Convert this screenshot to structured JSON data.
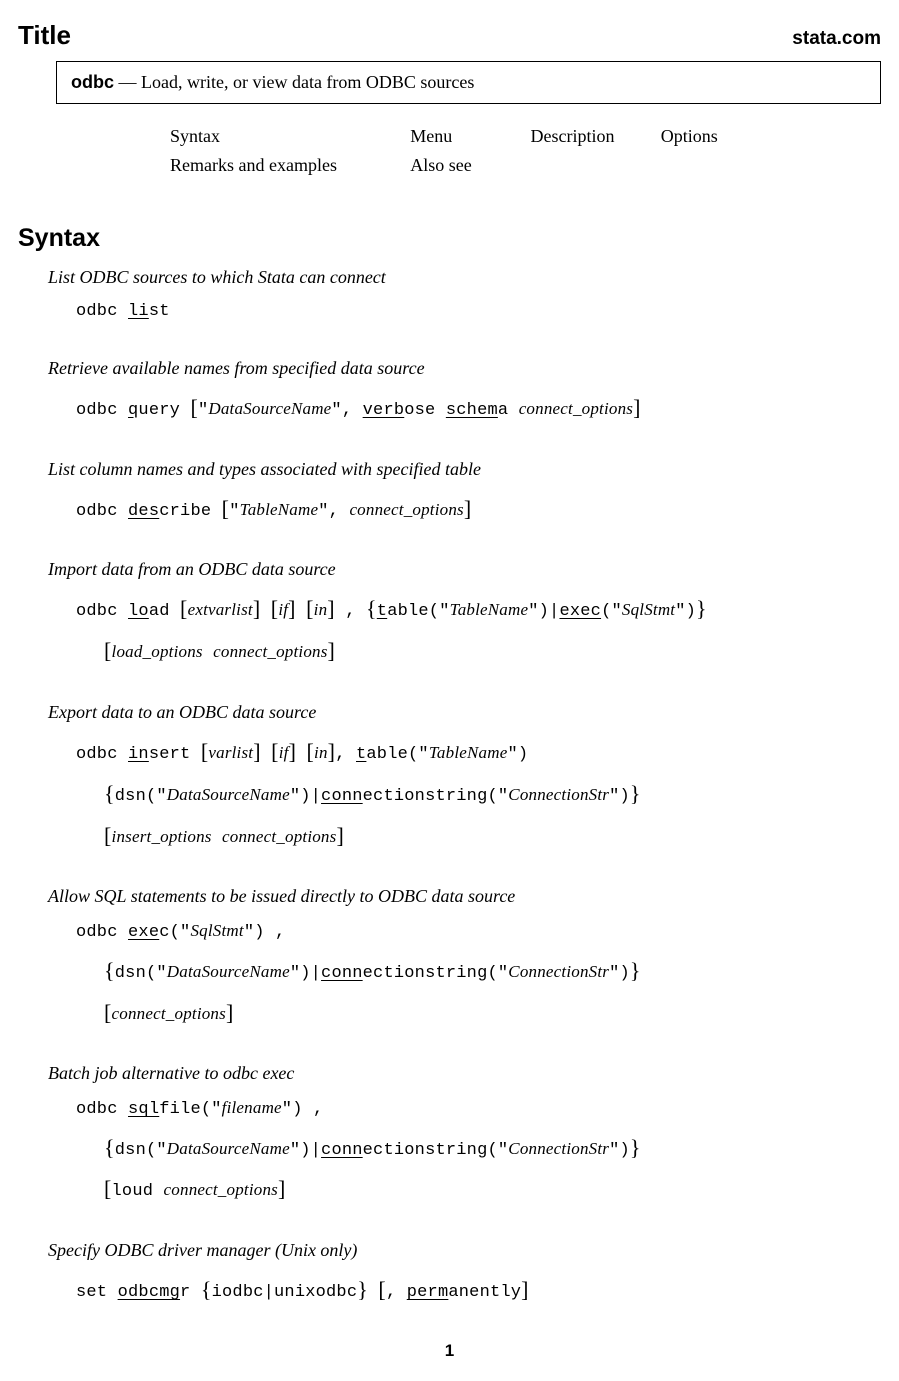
{
  "header": {
    "title": "Title",
    "brand": "stata.com"
  },
  "title_box": {
    "command": "odbc",
    "dash": " — ",
    "desc": "Load, write, or view data from ODBC sources"
  },
  "nav": {
    "syntax": "Syntax",
    "menu": "Menu",
    "description": "Description",
    "options": "Options",
    "remarks": "Remarks and examples",
    "also_see": "Also see"
  },
  "syntax_heading": "Syntax",
  "blocks": {
    "list": {
      "desc": "List ODBC sources to which Stata can connect"
    },
    "query": {
      "desc": "Retrieve available names from specified data source"
    },
    "describe": {
      "desc": "List column names and types associated with specified table"
    },
    "load": {
      "desc": "Import data from an ODBC data source"
    },
    "insert": {
      "desc": "Export data to an ODBC data source"
    },
    "exec": {
      "desc": "Allow SQL statements to be issued directly to ODBC data source"
    },
    "sqlfile": {
      "desc": "Batch job alternative to odbc exec"
    },
    "odbcmgr": {
      "desc": "Specify ODBC driver manager (Unix only)"
    }
  },
  "page_number": "1"
}
